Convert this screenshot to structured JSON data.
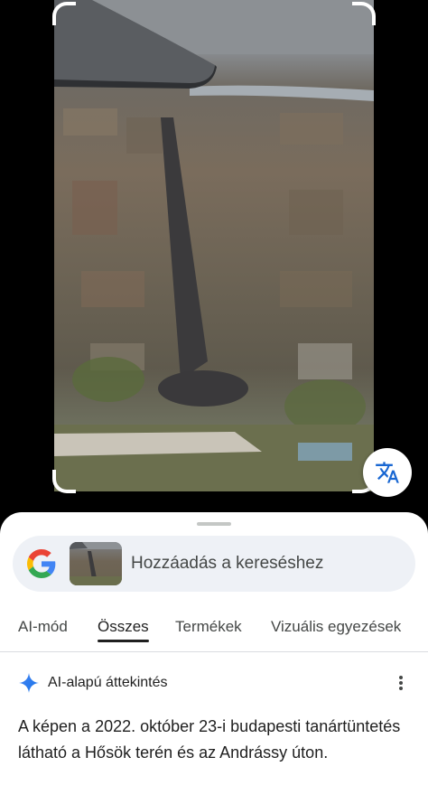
{
  "viewer": {
    "image_icon": "aerial-city-photo",
    "translate_icon": "translate-icon"
  },
  "search": {
    "logo_icon": "google-g-logo",
    "thumbnail_icon": "search-image-thumbnail",
    "placeholder": "Hozzáadás a kereséshez"
  },
  "tabs": [
    {
      "label": "AI-mód"
    },
    {
      "label": "Összes"
    },
    {
      "label": "Termékek"
    },
    {
      "label": "Vizuális egyezések"
    }
  ],
  "active_tab": "Összes",
  "overview": {
    "icon": "sparkle-icon",
    "title": "AI-alapú áttekintés",
    "menu_icon": "more-vert-icon",
    "text": "A képen a 2022. október 23-i budapesti tanártüntetés látható a Hősök terén és az Andrássy úton."
  },
  "colors": {
    "google_blue": "#4285F4",
    "google_red": "#EA4335",
    "google_yellow": "#FBBC05",
    "google_green": "#34A853",
    "search_bg": "#eef1f6"
  }
}
